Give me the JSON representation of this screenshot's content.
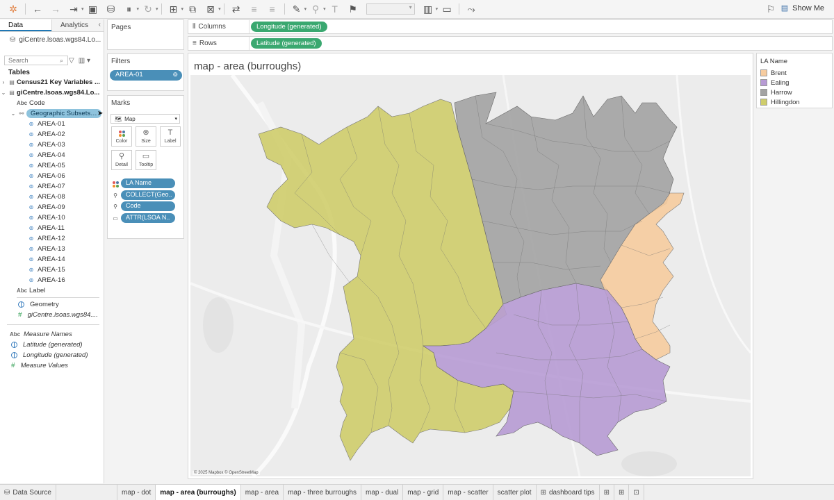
{
  "toolbar": {
    "show_me_label": "Show Me",
    "tools": [
      "tableau-logo-icon",
      "undo-icon",
      "redo-icon",
      "replay-icon",
      "save-icon",
      "new-datasource-icon",
      "pause-icon",
      "refresh-icon",
      "new-worksheet-icon",
      "duplicate-icon",
      "clear-icon",
      "swap-icon",
      "sort-asc-icon",
      "sort-desc-icon",
      "highlight-icon",
      "group-icon",
      "labels-icon",
      "pin-icon",
      "fit-icon",
      "presentation-icon",
      "share-icon"
    ]
  },
  "datapane": {
    "tab_data": "Data",
    "tab_analytics": "Analytics",
    "source_name": "giCentre.lsoas.wgs84.Lo...",
    "search_placeholder": "Search",
    "tables_heading": "Tables",
    "tables": [
      {
        "name": "Census21 Key Variables ..."
      },
      {
        "name": "giCentre.lsoas.wgs84.Lo..."
      }
    ],
    "fields_top": [
      "Code"
    ],
    "geo_subset_label": "Geographic Subsets ...",
    "areas": [
      "AREA-01",
      "AREA-02",
      "AREA-03",
      "AREA-04",
      "AREA-05",
      "AREA-06",
      "AREA-07",
      "AREA-08",
      "AREA-09",
      "AREA-10",
      "AREA-11",
      "AREA-12",
      "AREA-13",
      "AREA-14",
      "AREA-15",
      "AREA-16"
    ],
    "field_label": "Label",
    "field_geometry": "Geometry",
    "field_count": "giCentre.lsoas.wgs84....",
    "measures": [
      "Measure Names",
      "Latitude (generated)",
      "Longitude (generated)",
      "Measure Values"
    ]
  },
  "pages": {
    "title": "Pages"
  },
  "filters": {
    "title": "Filters",
    "pill": "AREA-01"
  },
  "marks": {
    "title": "Marks",
    "mark_type": "Map",
    "buttons": [
      "Color",
      "Size",
      "Label",
      "Detail",
      "Tooltip"
    ],
    "fields": [
      "LA Name",
      "COLLECT(Geo..",
      "Code",
      "ATTR(LSOA N.."
    ]
  },
  "shelves": {
    "columns_label": "Columns",
    "columns_pill": "Longitude (generated)",
    "rows_label": "Rows",
    "rows_pill": "Latitude (generated)"
  },
  "view": {
    "title": "map - area (burroughs)",
    "attribution": "© 2025 Mapbox © OpenStreetMap"
  },
  "legend": {
    "title": "LA Name",
    "items": [
      {
        "label": "Brent",
        "color": "#f6cc9f"
      },
      {
        "label": "Ealing",
        "color": "#b79bd4"
      },
      {
        "label": "Harrow",
        "color": "#a3a3a3"
      },
      {
        "label": "Hillingdon",
        "color": "#cfcd6c"
      }
    ]
  },
  "tabs": {
    "data_source": "Data Source",
    "sheets": [
      "map - dot",
      "map - area (burroughs)",
      "map - area",
      "map - three burroughs",
      "map - dual",
      "map - grid",
      "map - scatter",
      "scatter plot",
      "dashboard tips"
    ],
    "active_index": 1
  }
}
